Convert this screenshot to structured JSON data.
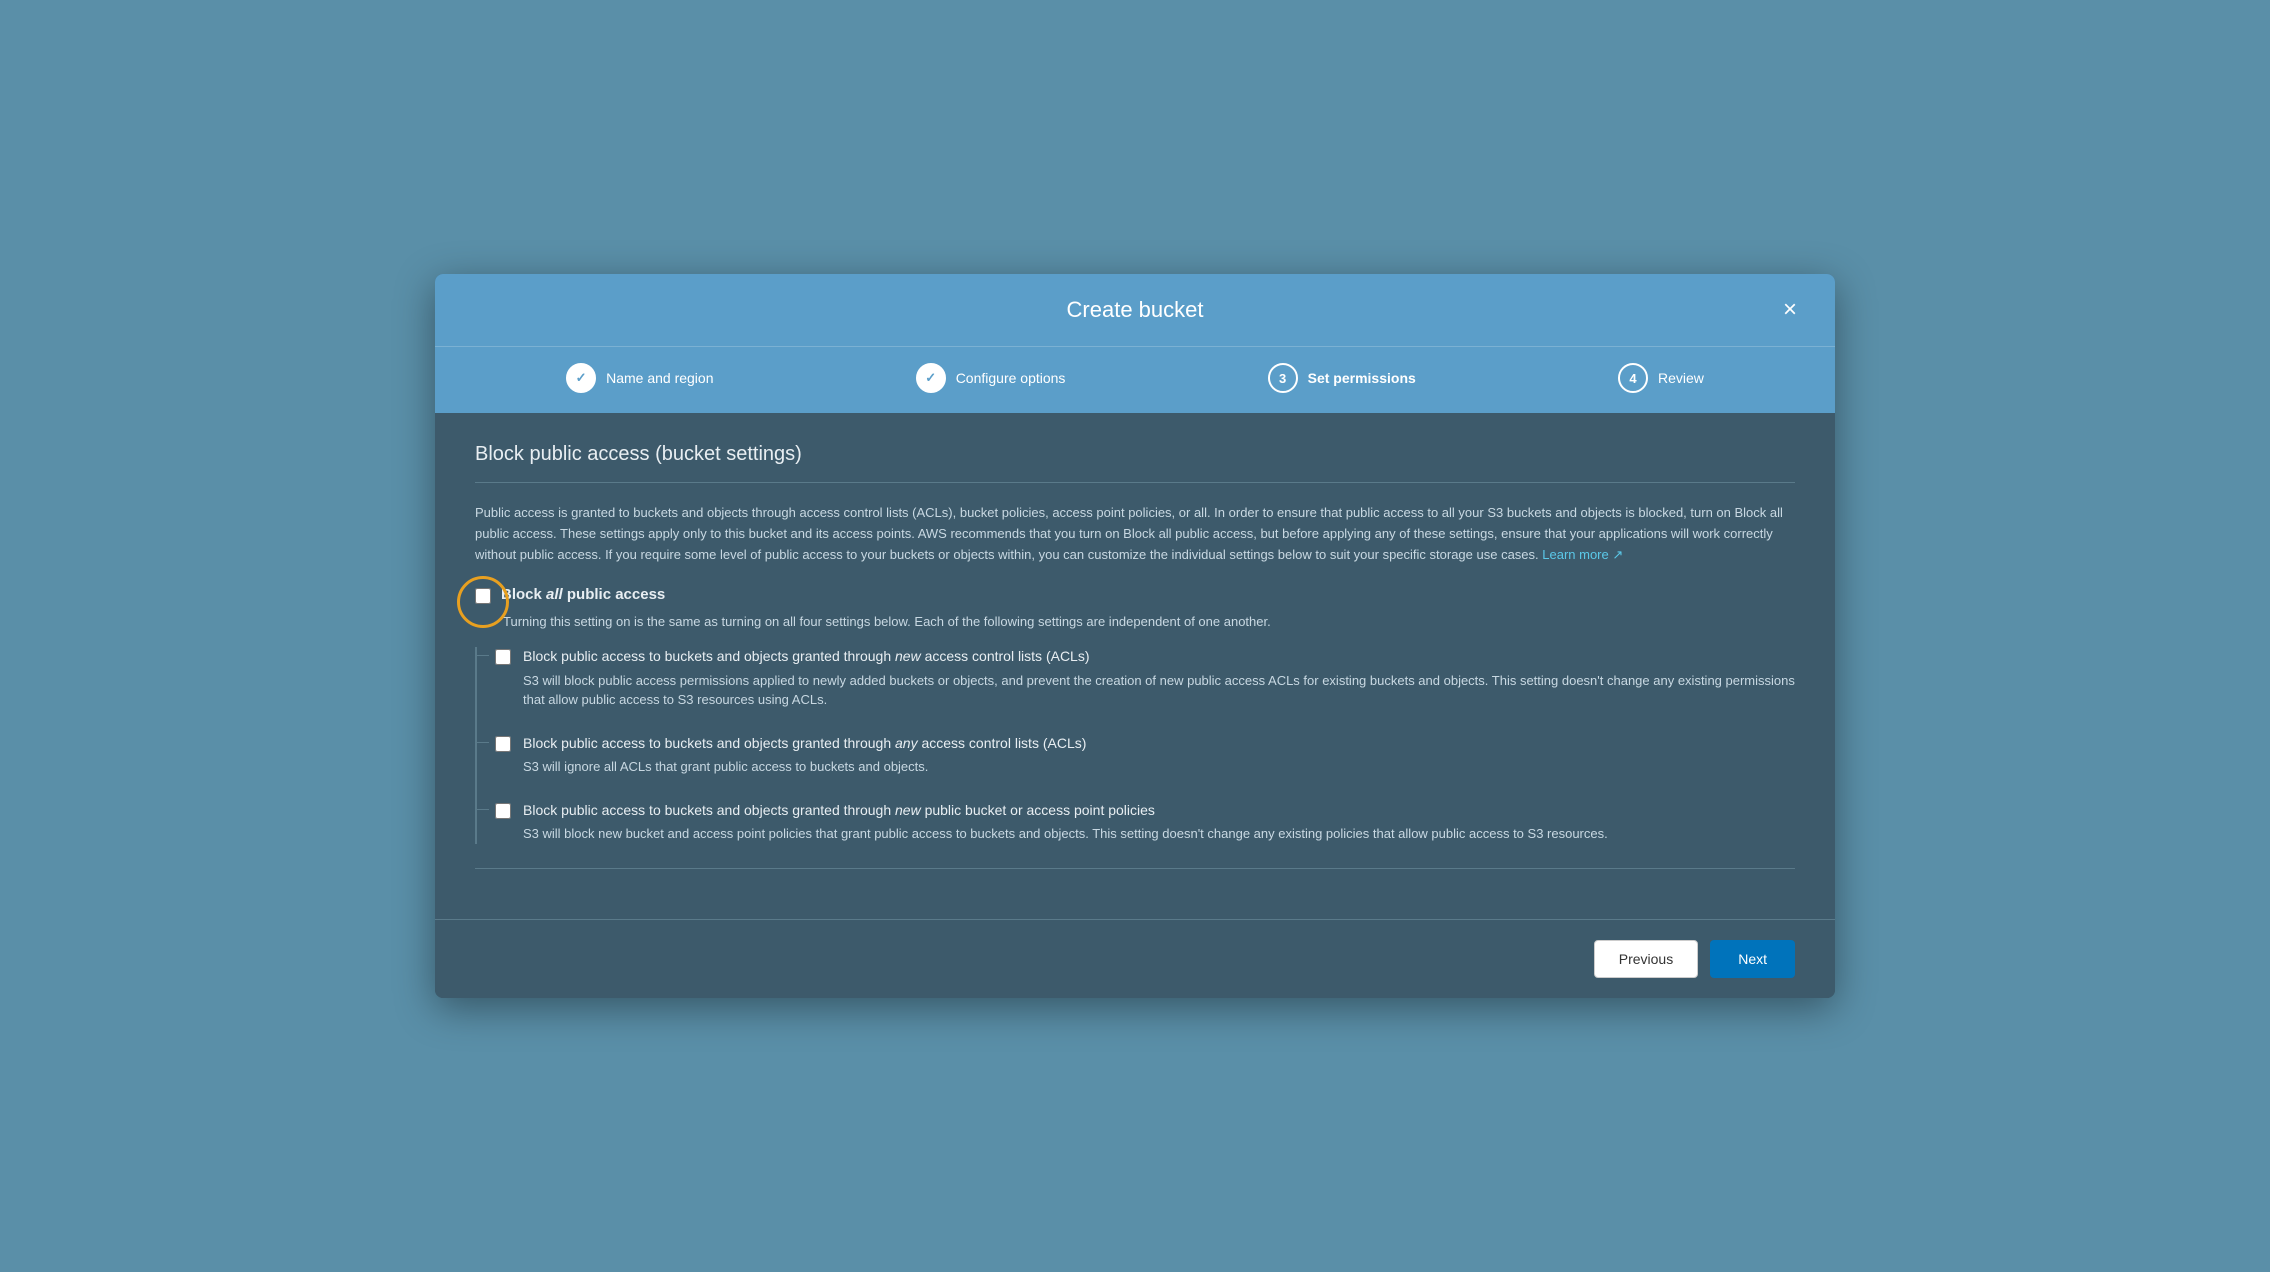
{
  "modal": {
    "title": "Create bucket",
    "close_label": "×"
  },
  "stepper": {
    "steps": [
      {
        "id": 1,
        "label": "Name and region",
        "status": "completed",
        "icon": "✓"
      },
      {
        "id": 2,
        "label": "Configure options",
        "status": "completed",
        "icon": "✓"
      },
      {
        "id": 3,
        "label": "Set permissions",
        "status": "active",
        "icon": "3"
      },
      {
        "id": 4,
        "label": "Review",
        "status": "inactive",
        "icon": "4"
      }
    ]
  },
  "section": {
    "title": "Block public access (bucket settings)",
    "description": "Public access is granted to buckets and objects through access control lists (ACLs), bucket policies, access point policies, or all. In order to ensure that public access to all your S3 buckets and objects is blocked, turn on Block all public access. These settings apply only to this bucket and its access points. AWS recommends that you turn on Block all public access, but before applying any of these settings, ensure that your applications will work correctly without public access. If you require some level of public access to your buckets or objects within, you can customize the individual settings below to suit your specific storage use cases.",
    "learn_more": "Learn more",
    "main_checkbox": {
      "label": "Block all public access",
      "sublabel": "Turning this setting on is the same as turning on all four settings below. Each of the following settings are independent of one another."
    },
    "sub_options": [
      {
        "id": "opt1",
        "title_parts": [
          "Block public access to buckets and objects granted through ",
          "new",
          " access control lists (ACLs)"
        ],
        "italic_word": "new",
        "description": "S3 will block public access permissions applied to newly added buckets or objects, and prevent the creation of new public access ACLs for existing buckets and objects. This setting doesn't change any existing permissions that allow public access to S3 resources using ACLs."
      },
      {
        "id": "opt2",
        "title_parts": [
          "Block public access to buckets and objects granted through ",
          "any",
          " access control lists (ACLs)"
        ],
        "italic_word": "any",
        "description": "S3 will ignore all ACLs that grant public access to buckets and objects."
      },
      {
        "id": "opt3",
        "title_parts": [
          "Block public access to buckets and objects granted through ",
          "new",
          " public bucket or access point policies"
        ],
        "italic_word": "new",
        "description": "S3 will block new bucket and access point policies that grant public access to buckets and objects. This setting doesn't change any existing policies that allow public access to S3 resources."
      }
    ]
  },
  "footer": {
    "previous_label": "Previous",
    "next_label": "Next"
  }
}
